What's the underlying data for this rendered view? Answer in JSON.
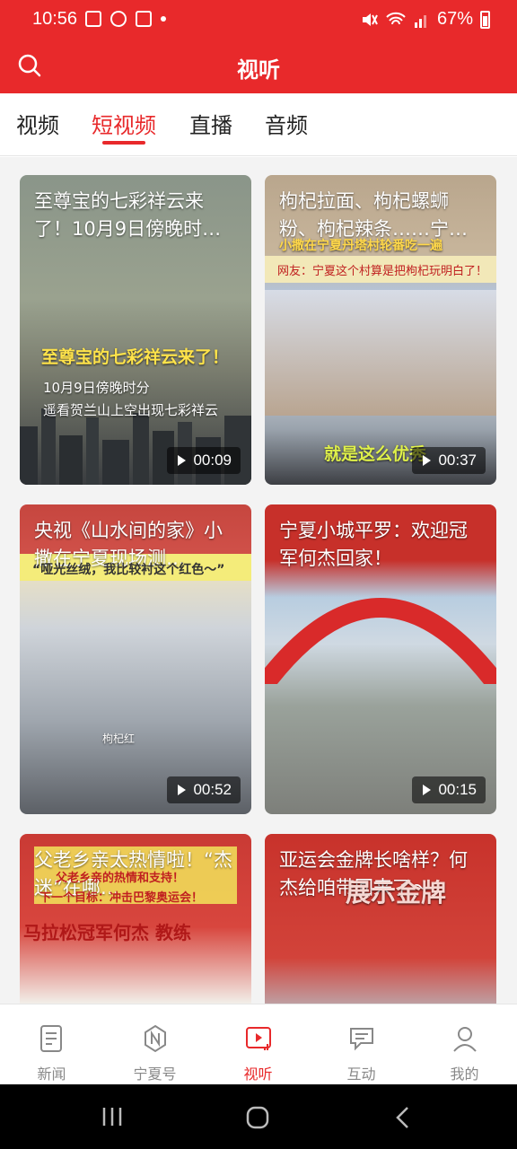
{
  "status": {
    "time": "10:56",
    "battery": "67%"
  },
  "header": {
    "title": "视听"
  },
  "tabs": [
    {
      "label": "视频",
      "active": false
    },
    {
      "label": "短视频",
      "active": true
    },
    {
      "label": "直播",
      "active": false
    },
    {
      "label": "音频",
      "active": false
    }
  ],
  "videos": [
    {
      "title": "至尊宝的七彩祥云来了！10月9日傍晚时…",
      "duration": "00:09",
      "overlay_main": "至尊宝的七彩祥云来了！",
      "overlay_line1": "10月9日傍晚时分",
      "overlay_line2": "遥看贺兰山上空出现七彩祥云"
    },
    {
      "title": "枸杞拉面、枸杞螺蛳粉、枸杞辣条……宁…",
      "duration": "00:37",
      "overlay_main": "小撒在宁夏丹塔村轮番吃一遍",
      "overlay_line1": "网友：宁夏这个村算是把枸杞玩明白了！",
      "overlay_line2": "就是这么优秀"
    },
    {
      "title": "央视《山水间的家》小撒在宁夏现场测…",
      "duration": "00:52",
      "overlay_main": "“哑光丝绒，我比较衬这个红色～”",
      "overlay_line1": "枸杞红",
      "overlay_line2": ""
    },
    {
      "title": "宁夏小城平罗：欢迎冠军何杰回家！",
      "duration": "00:15",
      "overlay_main": "",
      "overlay_line1": "",
      "overlay_line2": ""
    },
    {
      "title": "父老乡亲太热情啦！“杰迷”在哪…",
      "duration": "",
      "overlay_main": "父老乡亲的热情和支持！",
      "overlay_line1": "下一个目标：冲击巴黎奥运会！",
      "overlay_line2": "马拉松冠军何杰 教练"
    },
    {
      "title": "亚运会金牌长啥样？何杰给咱带回来了～",
      "duration": "",
      "overlay_main": "展示金牌",
      "overlay_line1": "",
      "overlay_line2": ""
    }
  ],
  "bottom_nav": [
    {
      "label": "新闻",
      "icon": "news-icon",
      "active": false
    },
    {
      "label": "宁夏号",
      "icon": "ningxia-hao-icon",
      "active": false
    },
    {
      "label": "视听",
      "icon": "video-play-icon",
      "active": true
    },
    {
      "label": "互动",
      "icon": "chat-icon",
      "active": false
    },
    {
      "label": "我的",
      "icon": "profile-icon",
      "active": false
    }
  ],
  "colors": {
    "brand_red": "#e8292b",
    "inactive_gray": "#888888"
  }
}
